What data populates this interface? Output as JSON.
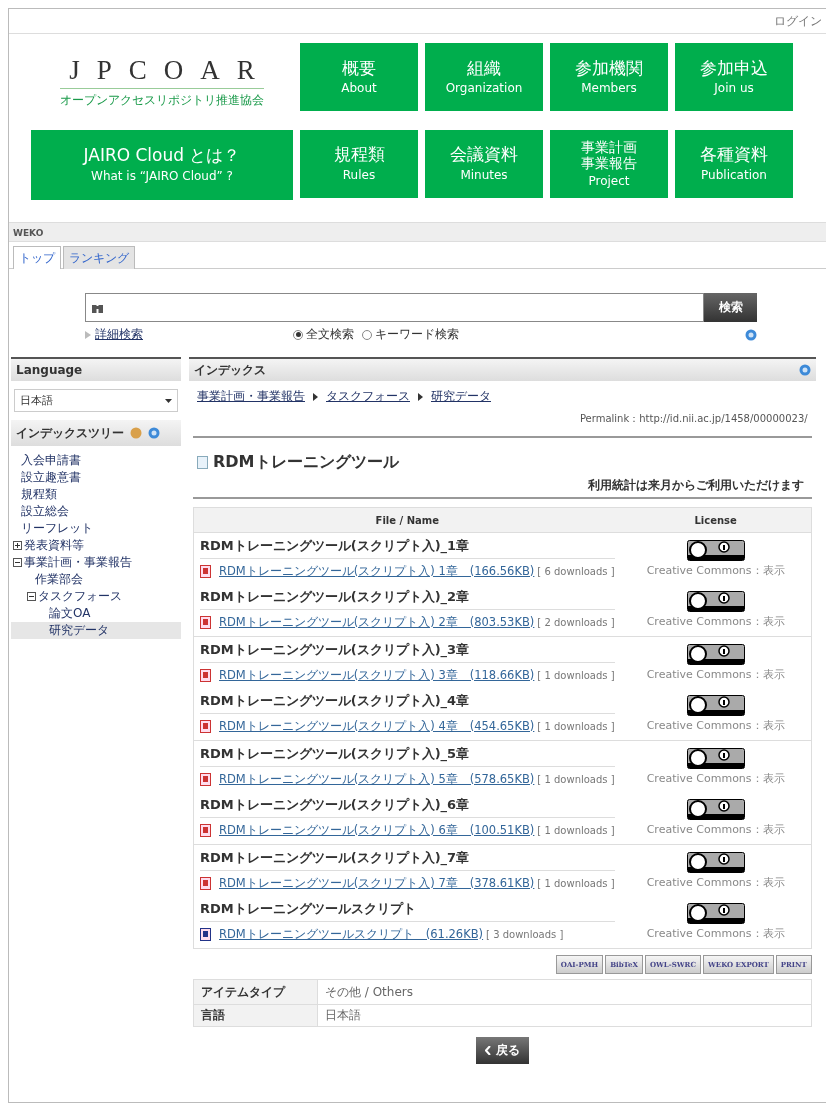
{
  "topbar": {
    "login": "ログイン"
  },
  "logo": {
    "title": "JPCOAR",
    "subtitle": "オープンアクセスリポジトリ推進協会"
  },
  "nav": [
    {
      "label": "概要",
      "sub": "About"
    },
    {
      "label": "組織",
      "sub": "Organization"
    },
    {
      "label": "参加機関",
      "sub": "Members"
    },
    {
      "label": "参加申込",
      "sub": "Join us"
    },
    {
      "label": "JAIRO Cloud とは？",
      "sub": "What is “JAIRO Cloud” ?",
      "kind": "wide"
    },
    {
      "label": "規程類",
      "sub": "Rules"
    },
    {
      "label": "会議資料",
      "sub": "Minutes"
    },
    {
      "label": "事業計画事業報告",
      "sub": "Project",
      "kind": "stacked"
    },
    {
      "label": "各種資料",
      "sub": "Publication"
    }
  ],
  "section_title": "WEKO",
  "tabs": [
    {
      "label": "トップ",
      "selected": true
    },
    {
      "label": "ランキング",
      "selected": false
    }
  ],
  "search": {
    "button": "検索",
    "advanced": "詳細検索",
    "modes": [
      {
        "label": "全文検索",
        "selected": true
      },
      {
        "label": "キーワード検索",
        "selected": false
      }
    ]
  },
  "sidebar": {
    "language_title": "Language",
    "language_value": "日本語",
    "tree_title": "インデックスツリー",
    "tree": [
      {
        "label": "入会申請書",
        "selected": false
      },
      {
        "label": "設立趣意書",
        "selected": false
      },
      {
        "label": "規程類",
        "selected": false
      },
      {
        "label": "設立総会",
        "selected": false
      },
      {
        "label": "リーフレット",
        "selected": false
      },
      {
        "label": "発表資料等",
        "selected": false,
        "expanded": false
      },
      {
        "label": "事業計画・事業報告",
        "selected": false,
        "expanded": true,
        "children": [
          {
            "label": "作業部会",
            "selected": false
          },
          {
            "label": "タスクフォース",
            "selected": false,
            "expanded": true,
            "children": [
              {
                "label": "論文OA",
                "selected": false
              },
              {
                "label": "研究データ",
                "selected": true
              }
            ]
          }
        ]
      }
    ]
  },
  "main": {
    "title": "インデックス",
    "breadcrumb": [
      "事業計画・事業報告",
      "タスクフォース",
      "研究データ"
    ],
    "permalink": "Permalink：http://id.nii.ac.jp/1458/00000023/",
    "item_title": "RDMトレーニングツール",
    "stats_note": "利用統計は来月からご利用いただけます",
    "columns": [
      "File / Name",
      "License"
    ],
    "files": [
      {
        "name": "RDMトレーニングツール(スクリプト入)_1章",
        "link": "RDMトレーニングツール(スクリプト入) 1章　(166.56KB)",
        "downloads": "[ 6 downloads ]",
        "kind": "pdf",
        "license": "Creative Commons：表示"
      },
      {
        "name": "RDMトレーニングツール(スクリプト入)_2章",
        "link": "RDMトレーニングツール(スクリプト入) 2章　(803.53KB)",
        "downloads": "[ 2 downloads ]",
        "kind": "pdf",
        "license": "Creative Commons：表示"
      },
      {
        "name": "RDMトレーニングツール(スクリプト入)_3章",
        "link": "RDMトレーニングツール(スクリプト入) 3章　(118.66KB)",
        "downloads": "[ 1 downloads ]",
        "kind": "pdf",
        "license": "Creative Commons：表示"
      },
      {
        "name": "RDMトレーニングツール(スクリプト入)_4章",
        "link": "RDMトレーニングツール(スクリプト入) 4章　(454.65KB)",
        "downloads": "[ 1 downloads ]",
        "kind": "pdf",
        "license": "Creative Commons：表示"
      },
      {
        "name": "RDMトレーニングツール(スクリプト入)_5章",
        "link": "RDMトレーニングツール(スクリプト入) 5章　(578.65KB)",
        "downloads": "[ 1 downloads ]",
        "kind": "pdf",
        "license": "Creative Commons：表示"
      },
      {
        "name": "RDMトレーニングツール(スクリプト入)_6章",
        "link": "RDMトレーニングツール(スクリプト入) 6章　(100.51KB)",
        "downloads": "[ 1 downloads ]",
        "kind": "pdf",
        "license": "Creative Commons：表示"
      },
      {
        "name": "RDMトレーニングツール(スクリプト入)_7章",
        "link": "RDMトレーニングツール(スクリプト入) 7章　(378.61KB)",
        "downloads": "[ 1 downloads ]",
        "kind": "pdf",
        "license": "Creative Commons：表示"
      },
      {
        "name": "RDMトレーニングツールスクリプト",
        "link": "RDMトレーニングツールスクリプト　(61.26KB)",
        "downloads": "[ 3 downloads ]",
        "kind": "word",
        "license": "Creative Commons：表示"
      }
    ],
    "exports": [
      "OAI-PMH",
      "BibTeX",
      "OWL-SWRC",
      "WEKO EXPORT",
      "PRINT"
    ],
    "metadata": [
      {
        "label": "アイテムタイプ",
        "value": "その他 / Others"
      },
      {
        "label": "言語",
        "value": "日本語"
      }
    ],
    "back": "戻る"
  }
}
